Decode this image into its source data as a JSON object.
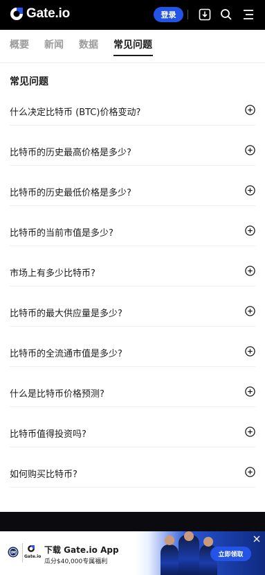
{
  "header": {
    "brand": "Gate.io",
    "login_label": "登录",
    "icons": [
      "download-icon",
      "search-icon",
      "menu-icon"
    ]
  },
  "tabs": [
    {
      "label": "概要",
      "active": false
    },
    {
      "label": "新闻",
      "active": false
    },
    {
      "label": "数据",
      "active": false
    },
    {
      "label": "常见问题",
      "active": true
    }
  ],
  "faq": {
    "title": "常见问题",
    "items": [
      {
        "question": "什么决定比特币 (BTC)价格变动?"
      },
      {
        "question": "比特币的历史最高价格是多少?"
      },
      {
        "question": "比特币的历史最低价格是多少?"
      },
      {
        "question": "比特币的当前市值是多少?"
      },
      {
        "question": "市场上有多少比特币?"
      },
      {
        "question": "比特币的最大供应量是多少?"
      },
      {
        "question": "比特币的全流通市值是多少?"
      },
      {
        "question": "什么是比特币价格预测?"
      },
      {
        "question": "比特币值得投资吗?"
      },
      {
        "question": "如何购买比特币?"
      }
    ]
  },
  "banner": {
    "title": "下载 Gate.io App",
    "subtitle": "瓜分$40,000专属福利",
    "cta_label": "立即领取",
    "mini_brand": "Gate.io"
  },
  "colors": {
    "accent": "#2354e6",
    "header_bg": "#000000",
    "text": "#1b1b1b",
    "muted": "#9b9b9b"
  }
}
